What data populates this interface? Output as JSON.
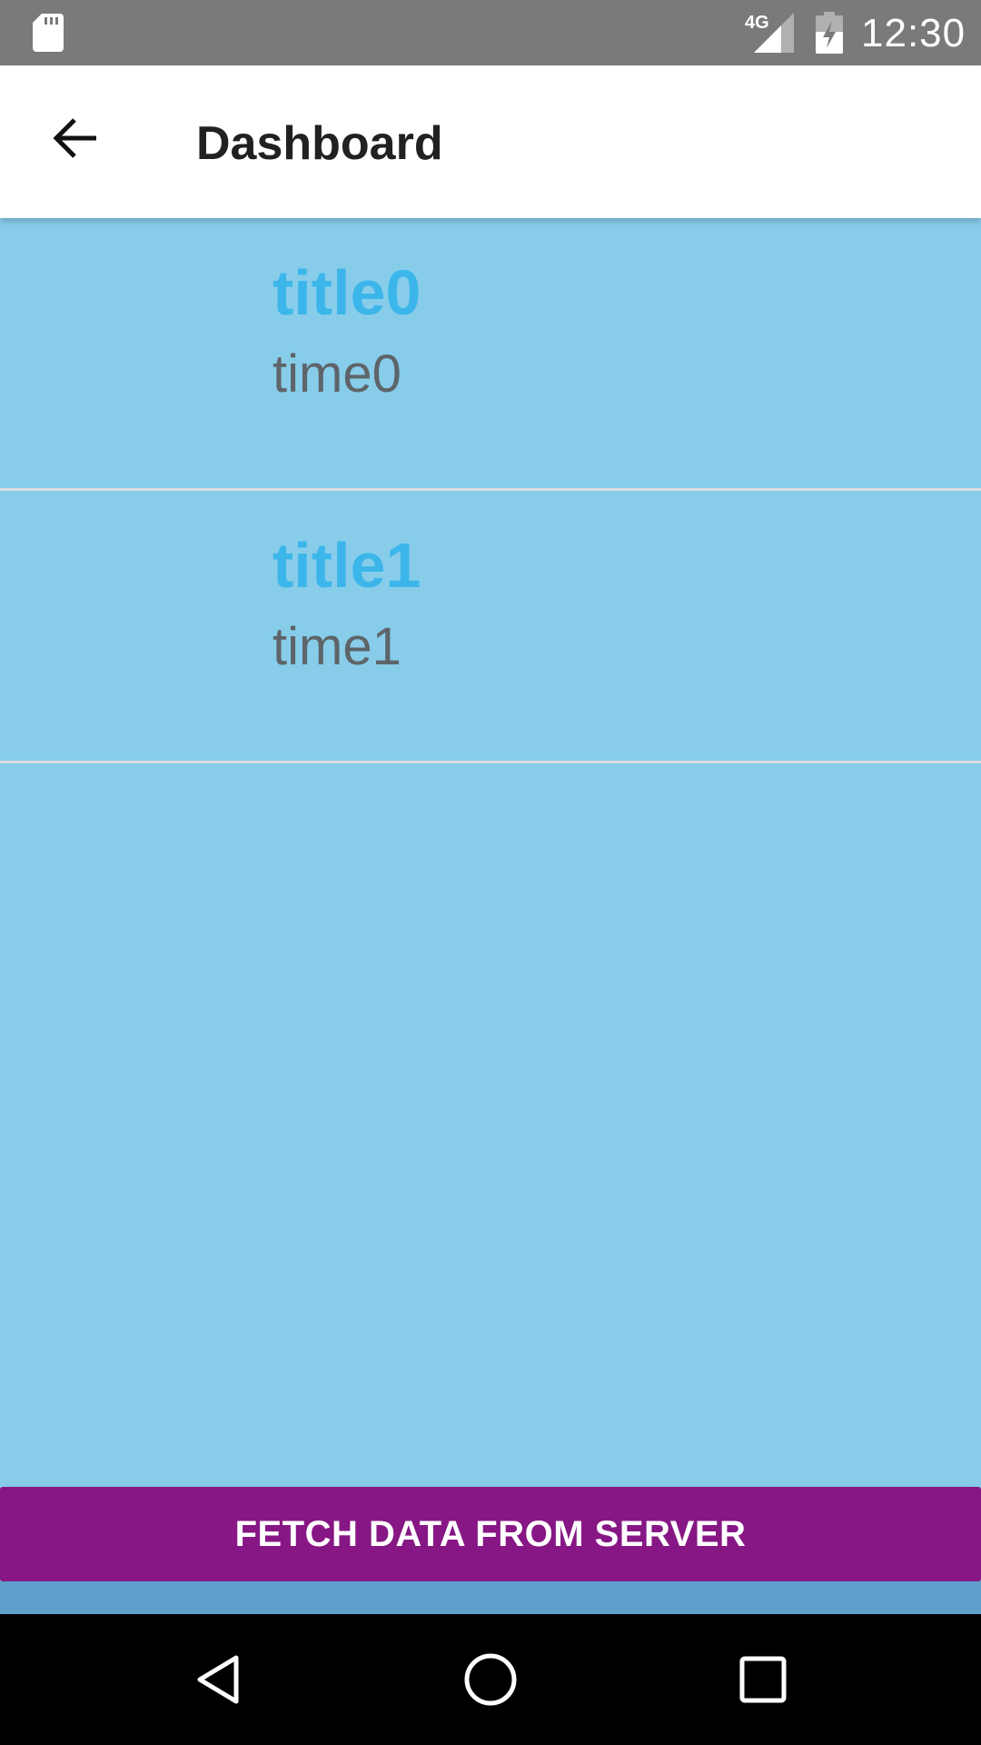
{
  "status_bar": {
    "network_label": "4G",
    "time": "12:30",
    "icons": [
      "sd-card-icon",
      "signal-icon",
      "battery-charging-icon"
    ]
  },
  "toolbar": {
    "back_icon": "arrow-back-icon",
    "title": "Dashboard"
  },
  "list": {
    "items": [
      {
        "title": "title0",
        "time": "time0"
      },
      {
        "title": "title1",
        "time": "time1"
      }
    ]
  },
  "fetch_button": {
    "label": "FETCH DATA FROM SERVER"
  },
  "nav_bar": {
    "icons": [
      "back-triangle-icon",
      "home-circle-icon",
      "recents-square-icon"
    ]
  },
  "colors": {
    "status_bar": "#7a7a7a",
    "background": "#87cdea",
    "title_text": "#3cb6ea",
    "time_text": "#5e6468",
    "button": "#861784",
    "nav_bar": "#000000"
  }
}
